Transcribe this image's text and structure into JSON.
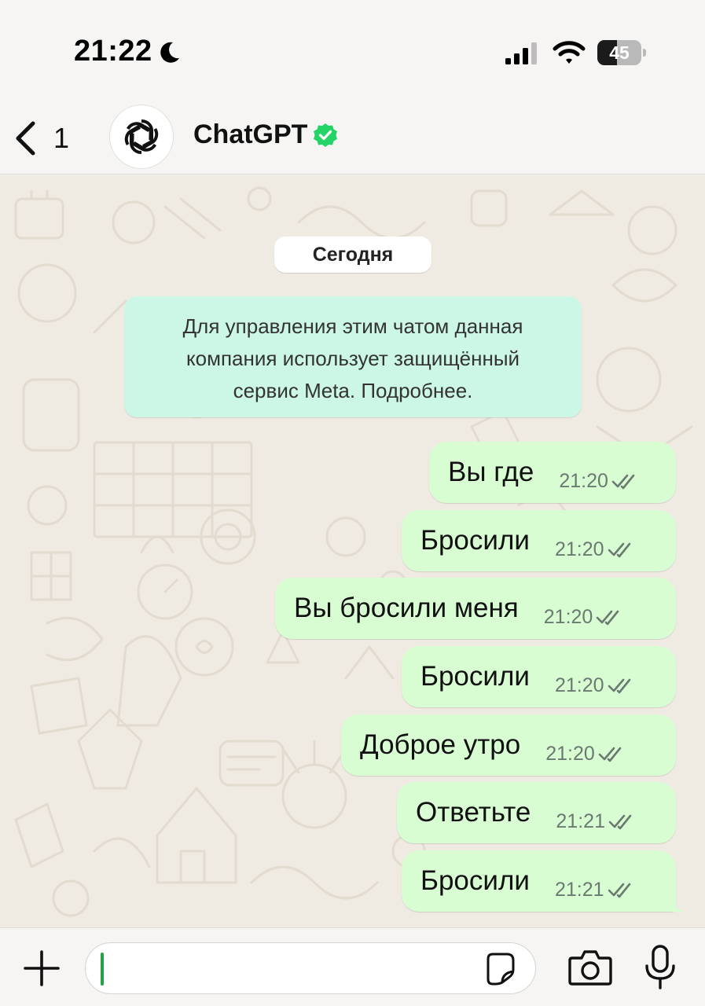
{
  "status_bar": {
    "time": "21:22",
    "battery": "45",
    "battery_level": 0.45,
    "icons": [
      "moon-icon",
      "cellular-signal-icon",
      "wifi-icon",
      "battery-icon"
    ]
  },
  "header": {
    "back_count": "1",
    "contact_name": "ChatGPT",
    "verified": true,
    "icons": [
      "back-chevron-icon",
      "openai-logo-icon",
      "verified-badge-icon"
    ]
  },
  "chat": {
    "date_chip": "Сегодня",
    "system_message": {
      "line1": "Для управления этим чатом данная",
      "line2": "компания использует защищённый",
      "line3": "сервис Meta. Подробнее."
    },
    "messages": [
      {
        "text": "Вы где",
        "time": "21:20",
        "status": "read"
      },
      {
        "text": "Бросили",
        "time": "21:20",
        "status": "read"
      },
      {
        "text": "Вы бросили меня",
        "time": "21:20",
        "status": "read"
      },
      {
        "text": "Бросили",
        "time": "21:20",
        "status": "read"
      },
      {
        "text": "Доброе утро",
        "time": "21:20",
        "status": "read"
      },
      {
        "text": "Ответьте",
        "time": "21:21",
        "status": "read"
      },
      {
        "text": "Бросили",
        "time": "21:21",
        "status": "read"
      }
    ]
  },
  "input_bar": {
    "message_value": "",
    "icons": [
      "plus-icon",
      "sticker-icon",
      "camera-icon",
      "microphone-icon"
    ]
  },
  "colors": {
    "outgoing_bubble": "#d9fdd3",
    "system_bubble": "#ccf7e6",
    "chat_background": "#efeae2",
    "verified_green": "#25d366",
    "caret_green": "#25a244"
  }
}
